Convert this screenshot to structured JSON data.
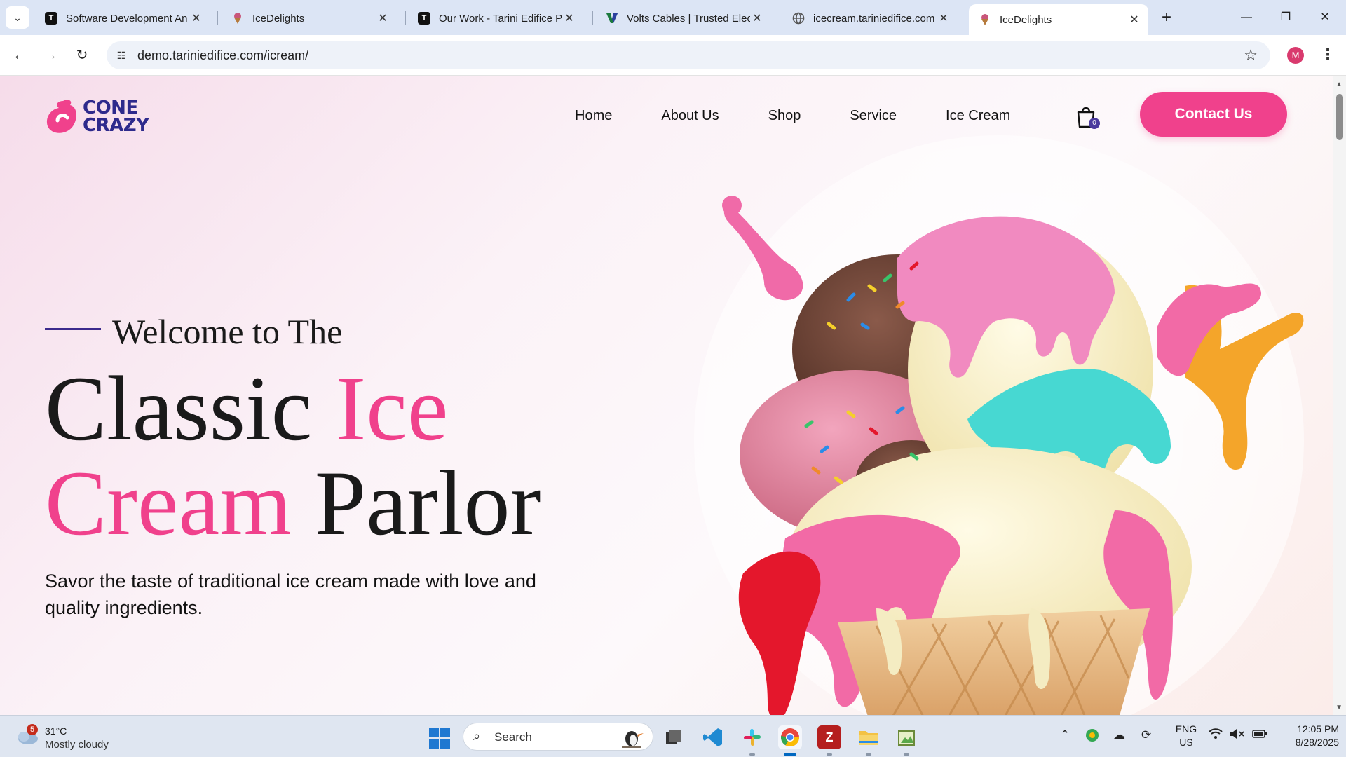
{
  "browser": {
    "tabs": [
      {
        "title": "Software Development An",
        "icon": "tarini-icon",
        "active": false
      },
      {
        "title": "IceDelights",
        "icon": "icedelights-icon",
        "active": false
      },
      {
        "title": "Our Work - Tarini Edifice P",
        "icon": "tarini-icon",
        "active": false
      },
      {
        "title": "Volts Cables | Trusted Elect",
        "icon": "volts-icon",
        "active": false
      },
      {
        "title": "icecream.tariniedifice.com",
        "icon": "globe-icon",
        "active": false
      },
      {
        "title": "IceDelights",
        "icon": "icedelights-icon",
        "active": true
      }
    ],
    "url": "demo.tariniedifice.com/icream/",
    "profile_initial": "M"
  },
  "site": {
    "logo_line1": "CONE",
    "logo_line2": "CRAZY",
    "nav": [
      "Home",
      "About Us",
      "Shop",
      "Service",
      "Ice Cream"
    ],
    "cart_count": "0",
    "contact_label": "Contact Us",
    "brand_pink": "#f0418c",
    "brand_navy": "#2e2a8c"
  },
  "hero": {
    "welcome": "Welcome to The",
    "title_w1": "Classic",
    "title_w2": "Ice",
    "title_w3": "Cream",
    "title_w4": "Parlor",
    "subtext": "Savor the taste of traditional ice cream made with love and quality ingredients."
  },
  "taskbar": {
    "weather_badge": "5",
    "temperature": "31°C",
    "condition": "Mostly cloudy",
    "search_placeholder": "Search",
    "lang_line1": "ENG",
    "lang_line2": "US",
    "time": "12:05 PM",
    "date": "8/28/2025"
  }
}
